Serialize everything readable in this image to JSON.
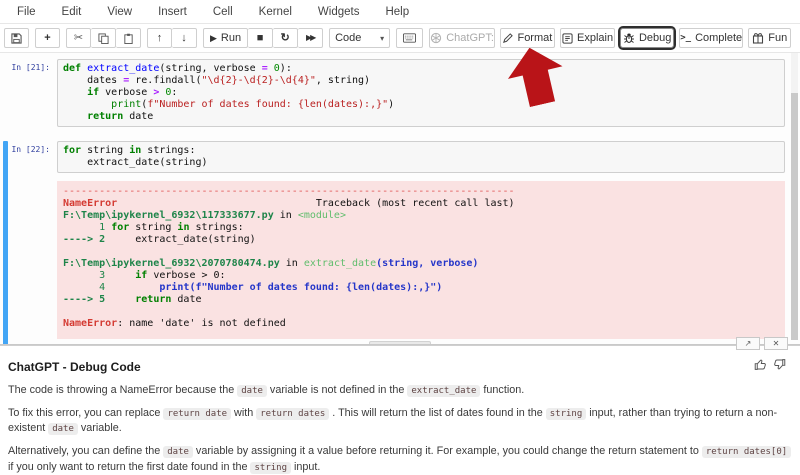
{
  "colors": {
    "accent": "#42a5f5",
    "error_bg": "#fae2e2",
    "arrow_red": "#b91418",
    "prompt_blue": "#303f9f"
  },
  "menu": {
    "items": [
      "File",
      "Edit",
      "View",
      "Insert",
      "Cell",
      "Kernel",
      "Widgets",
      "Help"
    ]
  },
  "toolbar": {
    "run_label": "Run",
    "cell_type": "Code",
    "chatgpt_label": "ChatGPT:",
    "format_label": "Format",
    "explain_label": "Explain",
    "debug_label": "Debug",
    "complete_label": "Complete",
    "fun_label": "Fun"
  },
  "cells": [
    {
      "prompt": "In [21]:",
      "lines": [
        [
          [
            "kw",
            "def"
          ],
          [
            "txt",
            " "
          ],
          [
            "def",
            "extract_date"
          ],
          [
            "txt",
            "(string, verbose "
          ],
          [
            "op",
            "="
          ],
          [
            "txt",
            " "
          ],
          [
            "num",
            "0"
          ],
          [
            "txt",
            "):"
          ]
        ],
        [
          [
            "txt",
            "    dates "
          ],
          [
            "op",
            "="
          ],
          [
            "txt",
            " re.findall("
          ],
          [
            "str",
            "\"\\d{2}-\\d{2}-\\d{4}\""
          ],
          [
            "txt",
            ", string)"
          ]
        ],
        [
          [
            "txt",
            "    "
          ],
          [
            "kw",
            "if"
          ],
          [
            "txt",
            " verbose "
          ],
          [
            "op",
            ">"
          ],
          [
            "txt",
            " "
          ],
          [
            "num",
            "0"
          ],
          [
            "txt",
            ":"
          ]
        ],
        [
          [
            "txt",
            "        "
          ],
          [
            "blt",
            "print"
          ],
          [
            "txt",
            "("
          ],
          [
            "str",
            "f\"Number of dates found: {len(dates):,}\""
          ],
          [
            "txt",
            ")"
          ]
        ],
        [
          [
            "txt",
            "    "
          ],
          [
            "kw",
            "return"
          ],
          [
            "txt",
            " date"
          ]
        ]
      ]
    },
    {
      "prompt": "In [22]:",
      "lines": [
        [
          [
            "kw",
            "for"
          ],
          [
            "txt",
            " string "
          ],
          [
            "kw",
            "in"
          ],
          [
            "txt",
            " strings:"
          ]
        ],
        [
          [
            "txt",
            "    extract_date(string)"
          ]
        ]
      ]
    }
  ],
  "traceback": {
    "lines": [
      [
        [
          "ansi-red",
          "---------------------------------------------------------------------------"
        ]
      ],
      [
        [
          "ansi-red-b",
          "NameError"
        ],
        [
          "txt",
          "                                 Traceback (most recent call last)"
        ]
      ],
      [
        [
          "ansi-green-b",
          "F:\\Temp\\ipykernel_6932\\117333677.py"
        ],
        [
          "txt",
          " in "
        ],
        [
          "ansi-lgreen",
          "<module>"
        ]
      ],
      [
        [
          "txt",
          "      "
        ],
        [
          "ansi-green",
          "1"
        ],
        [
          "txt",
          " "
        ],
        [
          "kw",
          "for"
        ],
        [
          "txt",
          " string "
        ],
        [
          "kw",
          "in"
        ],
        [
          "txt",
          " strings:"
        ]
      ],
      [
        [
          "ansi-green-b",
          "----> 2"
        ],
        [
          "txt",
          "     extract_date(string)"
        ]
      ],
      [
        [
          "txt",
          ""
        ]
      ],
      [
        [
          "ansi-green-b",
          "F:\\Temp\\ipykernel_6932\\2070780474.py"
        ],
        [
          "txt",
          " in "
        ],
        [
          "ansi-lgreen",
          "extract_date"
        ],
        [
          "ansi-blue-b",
          "(string, verbose)"
        ]
      ],
      [
        [
          "txt",
          "      "
        ],
        [
          "ansi-green",
          "3"
        ],
        [
          "txt",
          "     "
        ],
        [
          "kw",
          "if"
        ],
        [
          "txt",
          " verbose > 0:"
        ]
      ],
      [
        [
          "txt",
          "      "
        ],
        [
          "ansi-green",
          "4"
        ],
        [
          "ansi-blue-b",
          "         print(f\"Number of dates found: {len(dates):,}\")"
        ]
      ],
      [
        [
          "ansi-green-b",
          "----> 5"
        ],
        [
          "txt",
          "     "
        ],
        [
          "kw",
          "return"
        ],
        [
          "txt",
          " date"
        ]
      ],
      [
        [
          "txt",
          ""
        ]
      ],
      [
        [
          "ansi-red-b",
          "NameError"
        ],
        [
          "txt",
          ": name 'date' is not defined"
        ]
      ]
    ]
  },
  "panel": {
    "title": "ChatGPT - Debug Code",
    "paragraphs": [
      [
        {
          "t": "The code is throwing a NameError because the "
        },
        {
          "c": "date"
        },
        {
          "t": " variable is not defined in the "
        },
        {
          "c": "extract_date"
        },
        {
          "t": " function."
        }
      ],
      [
        {
          "t": "To fix this error, you can replace "
        },
        {
          "c": "return date"
        },
        {
          "t": " with "
        },
        {
          "c": "return dates"
        },
        {
          "t": " . This will return the list of dates found in the "
        },
        {
          "c": "string"
        },
        {
          "t": " input, rather than trying to return a non-existent "
        },
        {
          "c": "date"
        },
        {
          "t": " variable."
        }
      ],
      [
        {
          "t": "Alternatively, you can define the "
        },
        {
          "c": "date"
        },
        {
          "t": " variable by assigning it a value before returning it. For example, you could change the return statement to "
        },
        {
          "c": "return dates[0]"
        },
        {
          "t": " if you only want to return the first date found in the "
        },
        {
          "c": "string"
        },
        {
          "t": " input."
        }
      ]
    ]
  }
}
